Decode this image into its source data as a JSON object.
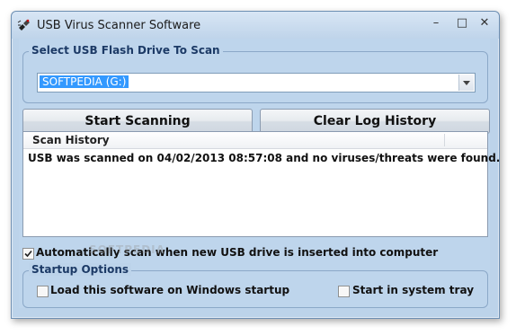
{
  "window": {
    "title": "USB Virus Scanner Software",
    "controls": [
      "minimize",
      "maximize",
      "close"
    ]
  },
  "select_drive": {
    "group_label": "Select USB Flash Drive To Scan",
    "selected_value": "SOFTPEDIA (G:)"
  },
  "buttons": {
    "start_scanning": "Start Scanning",
    "clear_log_history": "Clear Log History"
  },
  "scan_history": {
    "column_header": "Scan History",
    "rows": [
      "USB was scanned on 04/02/2013 08:57:08 and no viruses/threats were found."
    ]
  },
  "auto_scan": {
    "label": "Automatically scan when new USB drive is inserted into computer",
    "checked": true
  },
  "startup_options": {
    "group_label": "Startup Options",
    "load_on_startup": {
      "label": "Load this software on Windows startup",
      "checked": false
    },
    "start_in_tray": {
      "label": "Start in system tray",
      "checked": false
    }
  },
  "colors": {
    "window_bg": "#bed5ec",
    "selection_bg": "#3399ff",
    "group_label_text": "#1c3a66"
  }
}
